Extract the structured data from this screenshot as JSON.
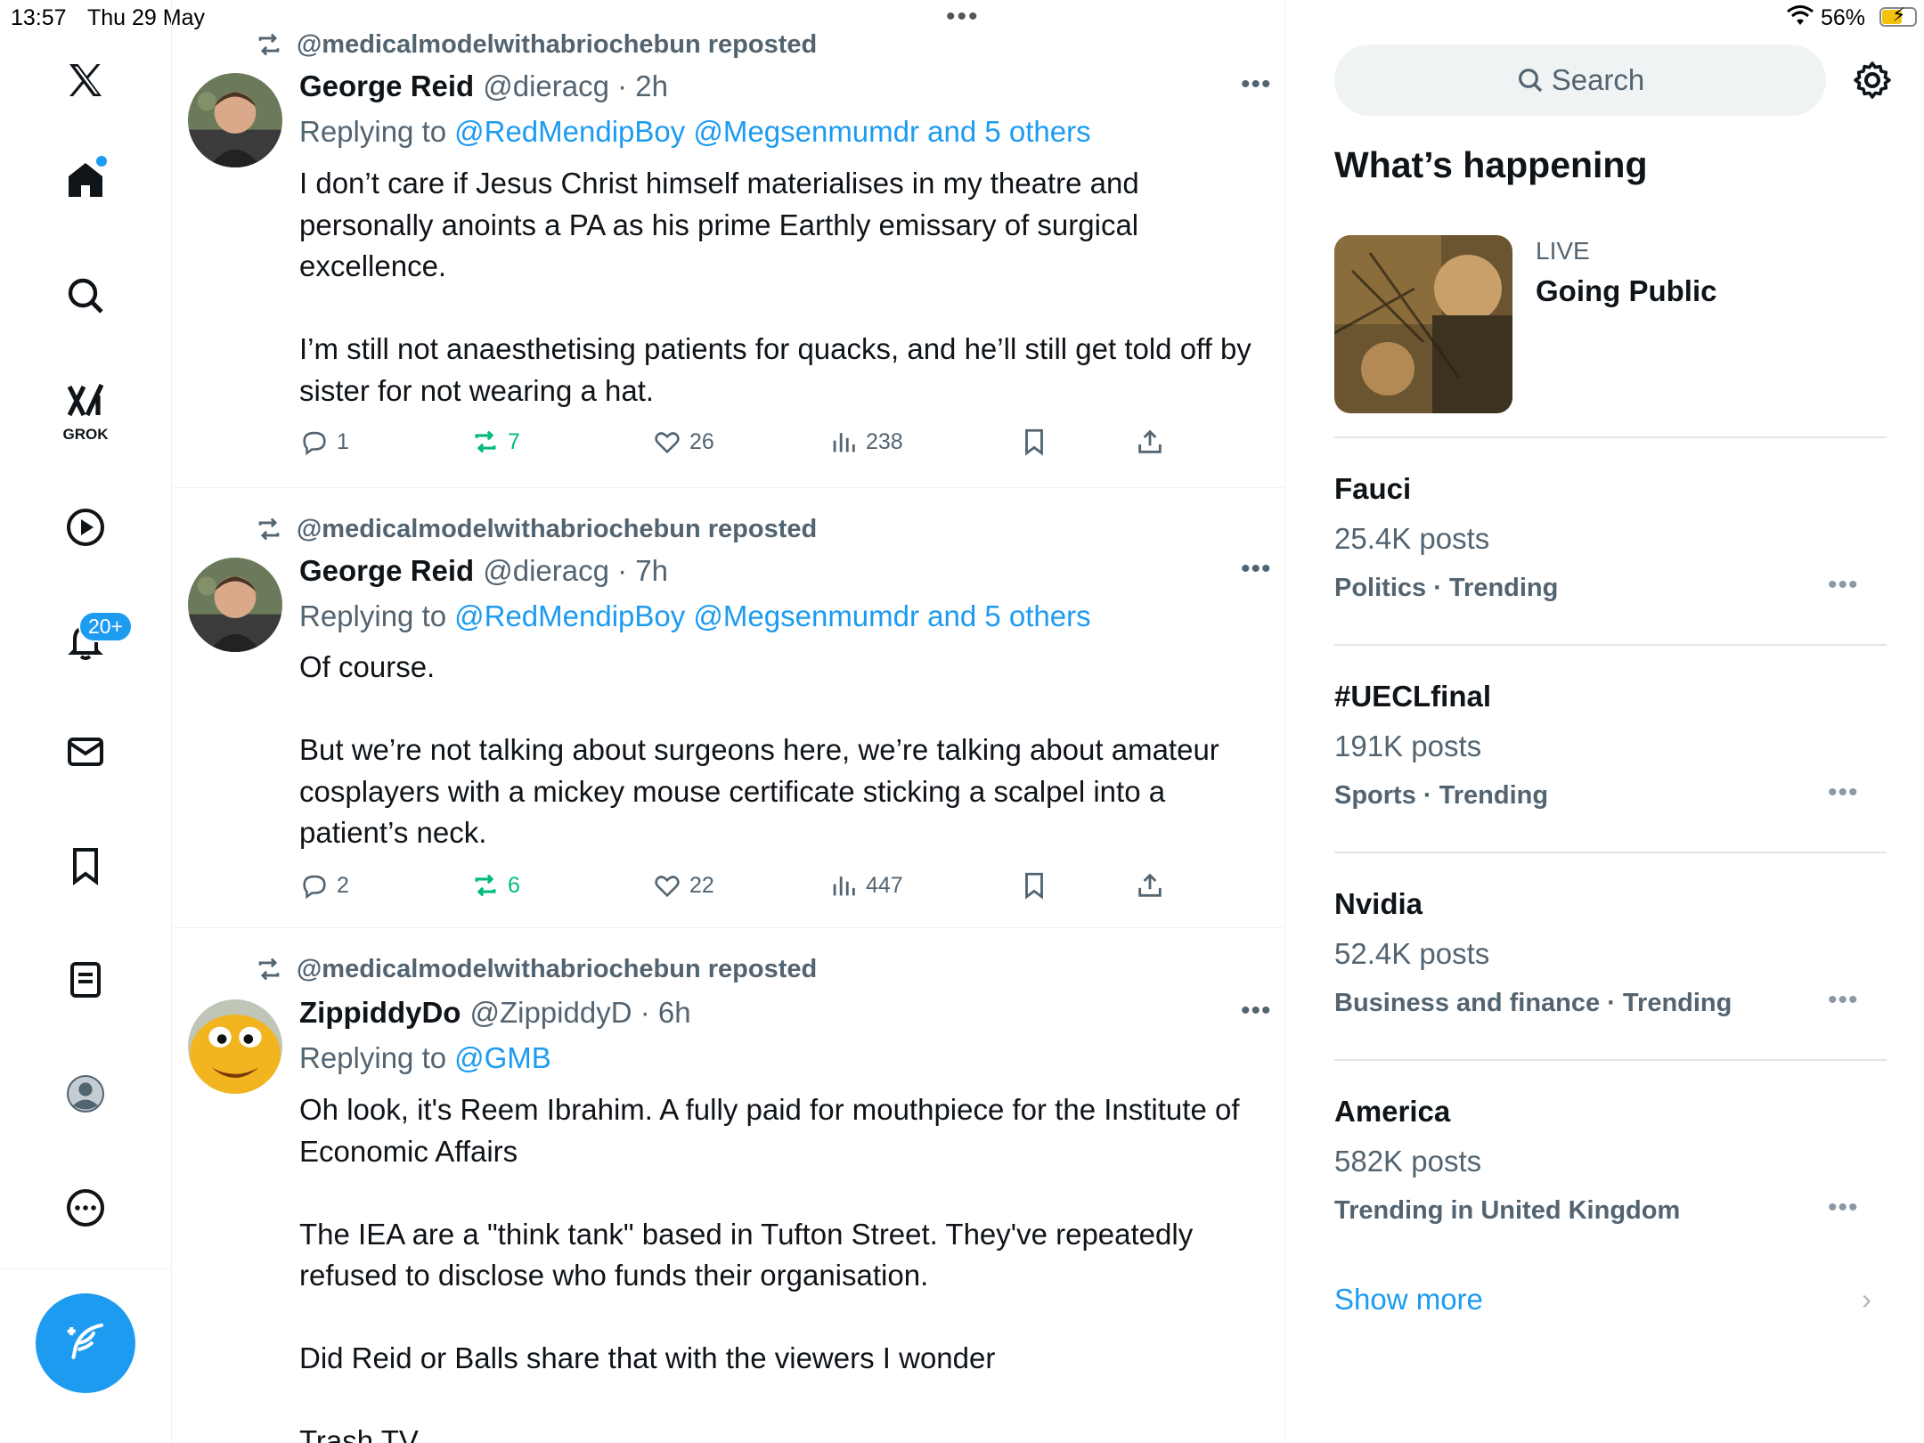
{
  "status_bar": {
    "time": "13:57",
    "date": "Thu 29 May",
    "battery": "56%"
  },
  "nav": {
    "grok_label": "GROK",
    "notifications_badge": "20+",
    "icons": [
      "x-logo-icon",
      "home-icon",
      "search-icon",
      "grok-icon",
      "video-icon",
      "bell-icon",
      "mail-icon",
      "bookmark-icon",
      "lists-icon",
      "profile-icon",
      "more-icon",
      "compose-icon"
    ]
  },
  "timeline": {
    "tweets": [
      {
        "repost": "@medicalmodelwithabriochebun reposted",
        "name": "George Reid",
        "meta": "@dieracg · 2h",
        "replying_prefix": "Replying to",
        "replying_to": "@RedMendipBoy @Megsenmumdr and 5 others",
        "paragraphs": [
          "I don’t care if Jesus Christ himself materialises in my theatre and personally anoints a PA as his prime Earthly emissary of surgical excellence.",
          "I’m still not anaesthetising patients for quacks, and he’ll still get told off by sister for not wearing a hat."
        ],
        "replies": "1",
        "reposts": "7",
        "likes": "26",
        "views": "238"
      },
      {
        "repost": "@medicalmodelwithabriochebun reposted",
        "name": "George Reid",
        "meta": "@dieracg · 7h",
        "replying_prefix": "Replying to",
        "replying_to": "@RedMendipBoy @Megsenmumdr and 5 others",
        "paragraphs": [
          "Of course.",
          "But we’re not talking about surgeons here, we’re talking about amateur cosplayers with a mickey mouse certificate sticking a scalpel into a patient’s neck."
        ],
        "replies": "2",
        "reposts": "6",
        "likes": "22",
        "views": "447"
      },
      {
        "repost": "@medicalmodelwithabriochebun reposted",
        "name": "ZippiddyDo",
        "meta": "@ZippiddyD · 6h",
        "replying_prefix": "Replying to",
        "replying_to": "@GMB",
        "paragraphs": [
          "Oh look, it's Reem Ibrahim. A fully paid for mouthpiece for the Institute of Economic Affairs",
          "The IEA are a \"think tank\" based in Tufton Street. They've repeatedly refused to disclose who funds their organisation.",
          "Did Reid or Balls share that with the viewers I wonder",
          "Trash TV"
        ]
      }
    ]
  },
  "sidebar": {
    "search_placeholder": "Search",
    "whats_happening": "What’s happening",
    "live": {
      "label": "LIVE",
      "title": "Going Public"
    },
    "trends": [
      {
        "name": "Fauci",
        "count": "25.4K posts",
        "category": "Politics · Trending"
      },
      {
        "name": "#UECLfinal",
        "count": "191K posts",
        "category": "Sports · Trending"
      },
      {
        "name": "Nvidia",
        "count": "52.4K posts",
        "category": "Business and finance · Trending"
      },
      {
        "name": "America",
        "count": "582K posts",
        "category": "Trending in United Kingdom"
      }
    ],
    "show_more": "Show more"
  },
  "colors": {
    "accent": "#1d9bf0",
    "repost_green": "#00ba7c",
    "muted": "#536471"
  }
}
